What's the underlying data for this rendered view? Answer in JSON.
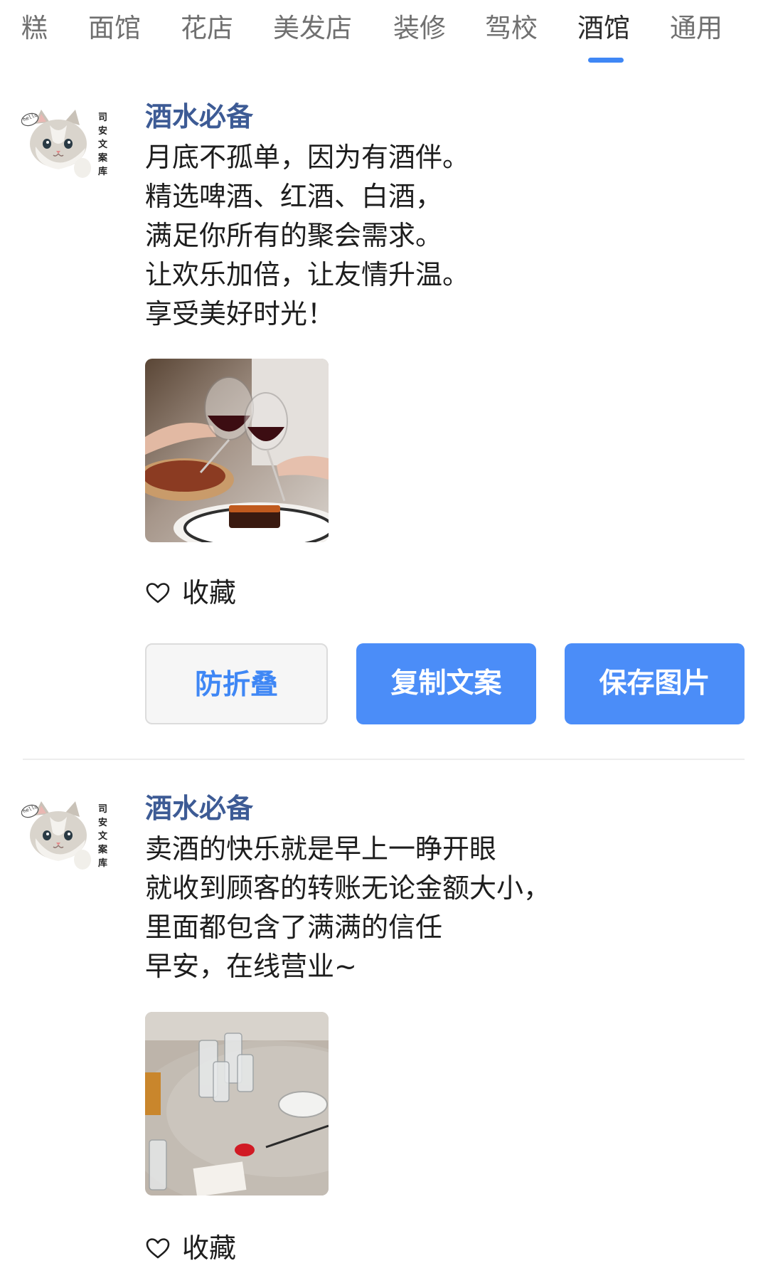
{
  "tabs": [
    {
      "label": "糕",
      "active": false
    },
    {
      "label": "面馆",
      "active": false
    },
    {
      "label": "花店",
      "active": false
    },
    {
      "label": "美发店",
      "active": false
    },
    {
      "label": "装修",
      "active": false
    },
    {
      "label": "驾校",
      "active": false
    },
    {
      "label": "酒馆",
      "active": true
    },
    {
      "label": "通用",
      "active": false
    }
  ],
  "colors": {
    "accent": "#3f87f5",
    "button_primary": "#4b8df8",
    "author_name": "#3d5b95",
    "tab_active": "#2b2b2b",
    "tab_inactive": "#707070"
  },
  "avatar": {
    "badge_text": "hello",
    "side_text": [
      "司",
      "安",
      "文",
      "案",
      "库"
    ]
  },
  "posts": [
    {
      "author": "酒水必备",
      "lines": [
        "月底不孤单，因为有酒伴。",
        "精选啤酒、红酒、白酒，",
        "满足你所有的聚会需求。",
        "让欢乐加倍，让友情升温。",
        "享受美好时光！"
      ],
      "image_icon": "wine-toast-photo",
      "favorite_label": "收藏",
      "actions": [
        "防折叠",
        "复制文案",
        "保存图片"
      ]
    },
    {
      "author": "酒水必备",
      "lines": [
        "卖酒的快乐就是早上一睁开眼",
        "就收到顾客的转账无论金额大小，",
        "里面都包含了满满的信任",
        "早安，在线营业~"
      ],
      "image_icon": "liquor-glasses-photo",
      "favorite_label": "收藏"
    }
  ]
}
